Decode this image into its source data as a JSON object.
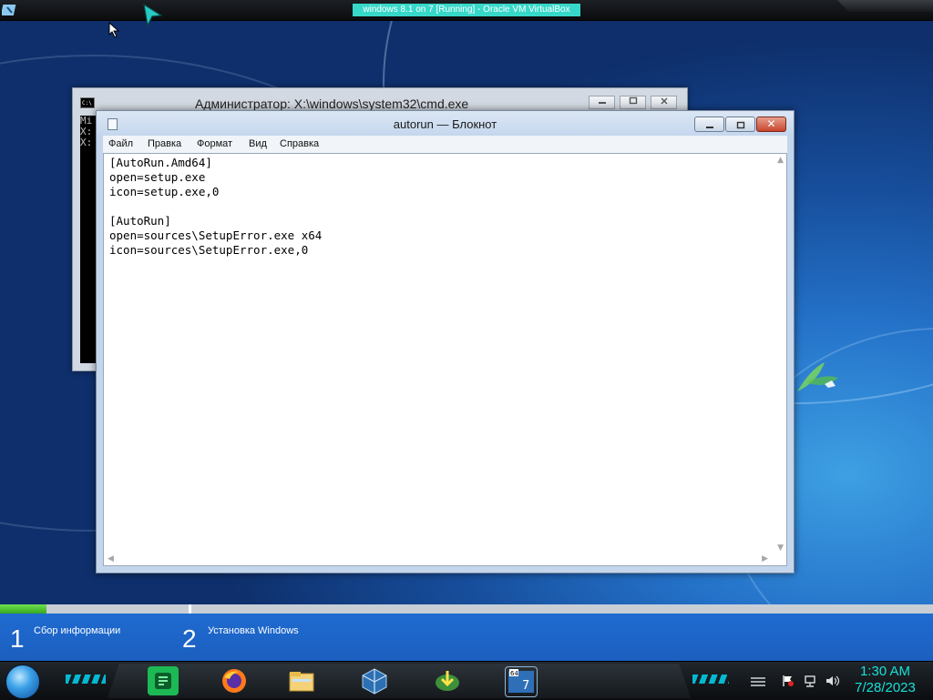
{
  "host": {
    "title": "windows 8.1 on 7 [Running] - Oracle VM VirtualBox"
  },
  "cmd_window": {
    "title": "Администратор: X:\\windows\\system32\\cmd.exe",
    "lines": [
      "Mi",
      "",
      "X:",
      "",
      "X:"
    ],
    "icon": "cmd-icon"
  },
  "notepad": {
    "title": "autorun — Блокнот",
    "menu": [
      "Файл",
      "Правка",
      "Формат",
      "Вид",
      "Справка"
    ],
    "content": [
      "[AutoRun.Amd64]",
      "open=setup.exe",
      "icon=setup.exe,0",
      "",
      "[AutoRun]",
      "open=sources\\SetupError.exe x64",
      "icon=sources\\SetupError.exe,0"
    ],
    "buttons": {
      "minimize": "minimize-icon",
      "maximize": "maximize-icon",
      "close": "✕"
    }
  },
  "setup": {
    "progress": 0.05,
    "steps": [
      {
        "number": "1",
        "label": "Сбор информации"
      },
      {
        "number": "2",
        "label": "Установка Windows"
      }
    ]
  },
  "taskbar": {
    "apps": [
      "notes-app-icon",
      "firefox-icon",
      "explorer-icon",
      "virtualbox-icon",
      "download-manager-icon",
      "windows7-vm-icon"
    ],
    "tray": [
      "action-center-icon",
      "network-icon",
      "volume-icon"
    ],
    "time": "1:30 AM",
    "date": "7/28/2023"
  },
  "colors": {
    "accent_cyan": "#17e0d8",
    "progress_green": "#4ccd2f",
    "setup_blue": "#1f6bd1"
  }
}
